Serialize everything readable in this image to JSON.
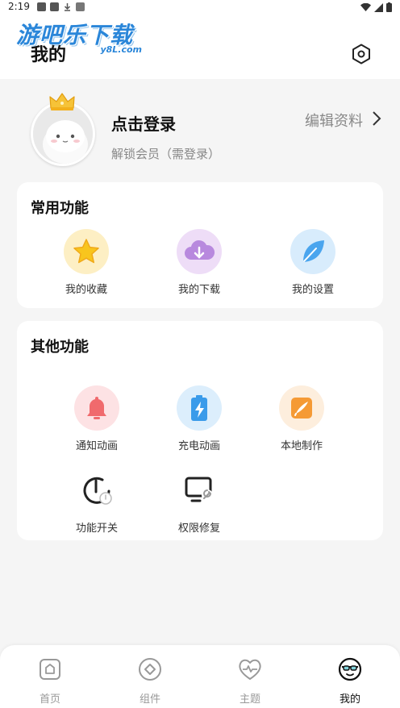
{
  "status_bar": {
    "time": "2:19"
  },
  "watermark": {
    "text": "游吧乐下载",
    "sub": "y8L.com"
  },
  "header": {
    "title": "我的"
  },
  "profile": {
    "login_label": "点击登录",
    "member_label": "解锁会员（需登录）",
    "edit_label": "编辑资料"
  },
  "common_functions": {
    "title": "常用功能",
    "items": [
      {
        "label": "我的收藏",
        "icon": "star-icon"
      },
      {
        "label": "我的下载",
        "icon": "cloud-download-icon"
      },
      {
        "label": "我的设置",
        "icon": "leaf-icon"
      }
    ]
  },
  "other_functions": {
    "title": "其他功能",
    "items": [
      {
        "label": "通知动画",
        "icon": "bell-icon"
      },
      {
        "label": "充电动画",
        "icon": "battery-icon"
      },
      {
        "label": "本地制作",
        "icon": "brush-icon"
      },
      {
        "label": "功能开关",
        "icon": "power-icon"
      },
      {
        "label": "权限修复",
        "icon": "wrench-screen-icon"
      }
    ]
  },
  "tabbar": {
    "tabs": [
      {
        "label": "首页",
        "icon": "home-icon",
        "active": false
      },
      {
        "label": "组件",
        "icon": "widget-icon",
        "active": false
      },
      {
        "label": "主题",
        "icon": "heart-pulse-icon",
        "active": false
      },
      {
        "label": "我的",
        "icon": "face-icon",
        "active": true
      }
    ]
  },
  "colors": {
    "watermark_blue": "#2a86d9",
    "star_bg": "#fdefc4",
    "download_bg": "#eeddf7",
    "leaf_bg": "#d8ecfc",
    "bell_bg": "#fde2e4",
    "battery_bg": "#dceefc",
    "brush_bg": "#fdeedd"
  }
}
